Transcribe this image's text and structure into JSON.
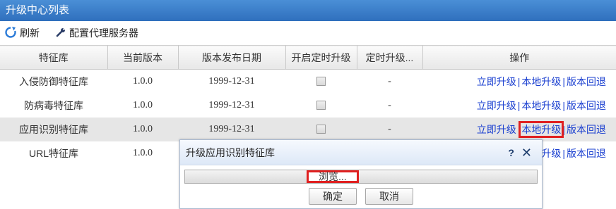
{
  "panel": {
    "title": "升级中心列表"
  },
  "toolbar": {
    "refresh_icon": "refresh-icon",
    "refresh_label": "刷新",
    "proxy_icon": "wrench-icon",
    "proxy_label": "配置代理服务器"
  },
  "table": {
    "columns": [
      "特征库",
      "当前版本",
      "版本发布日期",
      "开启定时升级",
      "定时升级...",
      "操作"
    ],
    "rows": [
      {
        "name": "入侵防御特征库",
        "version": "1.0.0",
        "date": "1999-12-31",
        "schedule": "-",
        "selected": false
      },
      {
        "name": "防病毒特征库",
        "version": "1.0.0",
        "date": "1999-12-31",
        "schedule": "-",
        "selected": false
      },
      {
        "name": "应用识别特征库",
        "version": "1.0.0",
        "date": "1999-12-31",
        "schedule": "-",
        "selected": true
      },
      {
        "name": "URL特征库",
        "version": "1.0.0",
        "date": "",
        "schedule": "",
        "selected": false
      }
    ],
    "actions": {
      "upgrade_now": "立即升级",
      "local_upgrade": "本地升级",
      "rollback": "版本回退",
      "separator": "|",
      "partial_upgrade": "升级"
    }
  },
  "dialog": {
    "title": "升级应用识别特征库",
    "help": "?",
    "close_icon": "close-icon",
    "browse_label": "浏览...",
    "ok_label": "确定",
    "cancel_label": "取消"
  },
  "colors": {
    "title_bar": "#2f6fbd",
    "link": "#1a3fd0",
    "highlight": "#e02020"
  }
}
